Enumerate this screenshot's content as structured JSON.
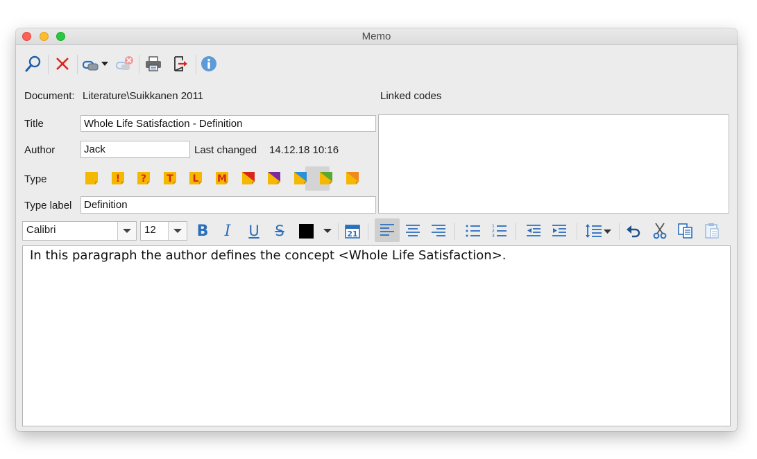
{
  "window": {
    "title": "Memo"
  },
  "toolbar": {
    "items": [
      "search-icon",
      "delete-icon",
      "link-icon",
      "unlink-icon",
      "print-icon",
      "export-icon",
      "info-icon"
    ]
  },
  "document": {
    "label": "Document:",
    "value": "Literature\\Suikkanen 2011"
  },
  "linked_codes": {
    "label": "Linked codes"
  },
  "title_field": {
    "label": "Title",
    "value": "Whole Life Satisfaction - Definition"
  },
  "author_field": {
    "label": "Author",
    "value": "Jack"
  },
  "last_changed": {
    "label": "Last changed",
    "value": "14.12.18 10:16"
  },
  "type": {
    "label": "Type",
    "icons": [
      {
        "name": "memo-type-plain-icon",
        "glyph": ""
      },
      {
        "name": "memo-type-exclamation-icon",
        "glyph": "!"
      },
      {
        "name": "memo-type-question-icon",
        "glyph": "?"
      },
      {
        "name": "memo-type-t-icon",
        "glyph": "T"
      },
      {
        "name": "memo-type-l-icon",
        "glyph": "L"
      },
      {
        "name": "memo-type-m-icon",
        "glyph": "M"
      },
      {
        "name": "memo-type-red-icon",
        "glyph": ""
      },
      {
        "name": "memo-type-purple-icon",
        "glyph": ""
      },
      {
        "name": "memo-type-blue-icon",
        "glyph": ""
      },
      {
        "name": "memo-type-green-icon",
        "glyph": ""
      },
      {
        "name": "memo-type-orange-icon",
        "glyph": ""
      }
    ],
    "selected": "memo-type-blue-icon"
  },
  "type_label": {
    "label": "Type label",
    "value": "Definition"
  },
  "format": {
    "font": "Calibri",
    "size": "12",
    "color": "#000000"
  },
  "colors": {
    "memo_yellow": "#f5b800",
    "memo_text": "#d8261c",
    "accent_blue": "#2a6ebd",
    "red": "#d8261c",
    "purple": "#7e2a9c",
    "blue": "#2d8fd8",
    "green": "#5aa832",
    "orange": "#f08a1c"
  },
  "editor": {
    "text": "In this paragraph the author defines the concept <Whole Life Satisfaction>."
  }
}
